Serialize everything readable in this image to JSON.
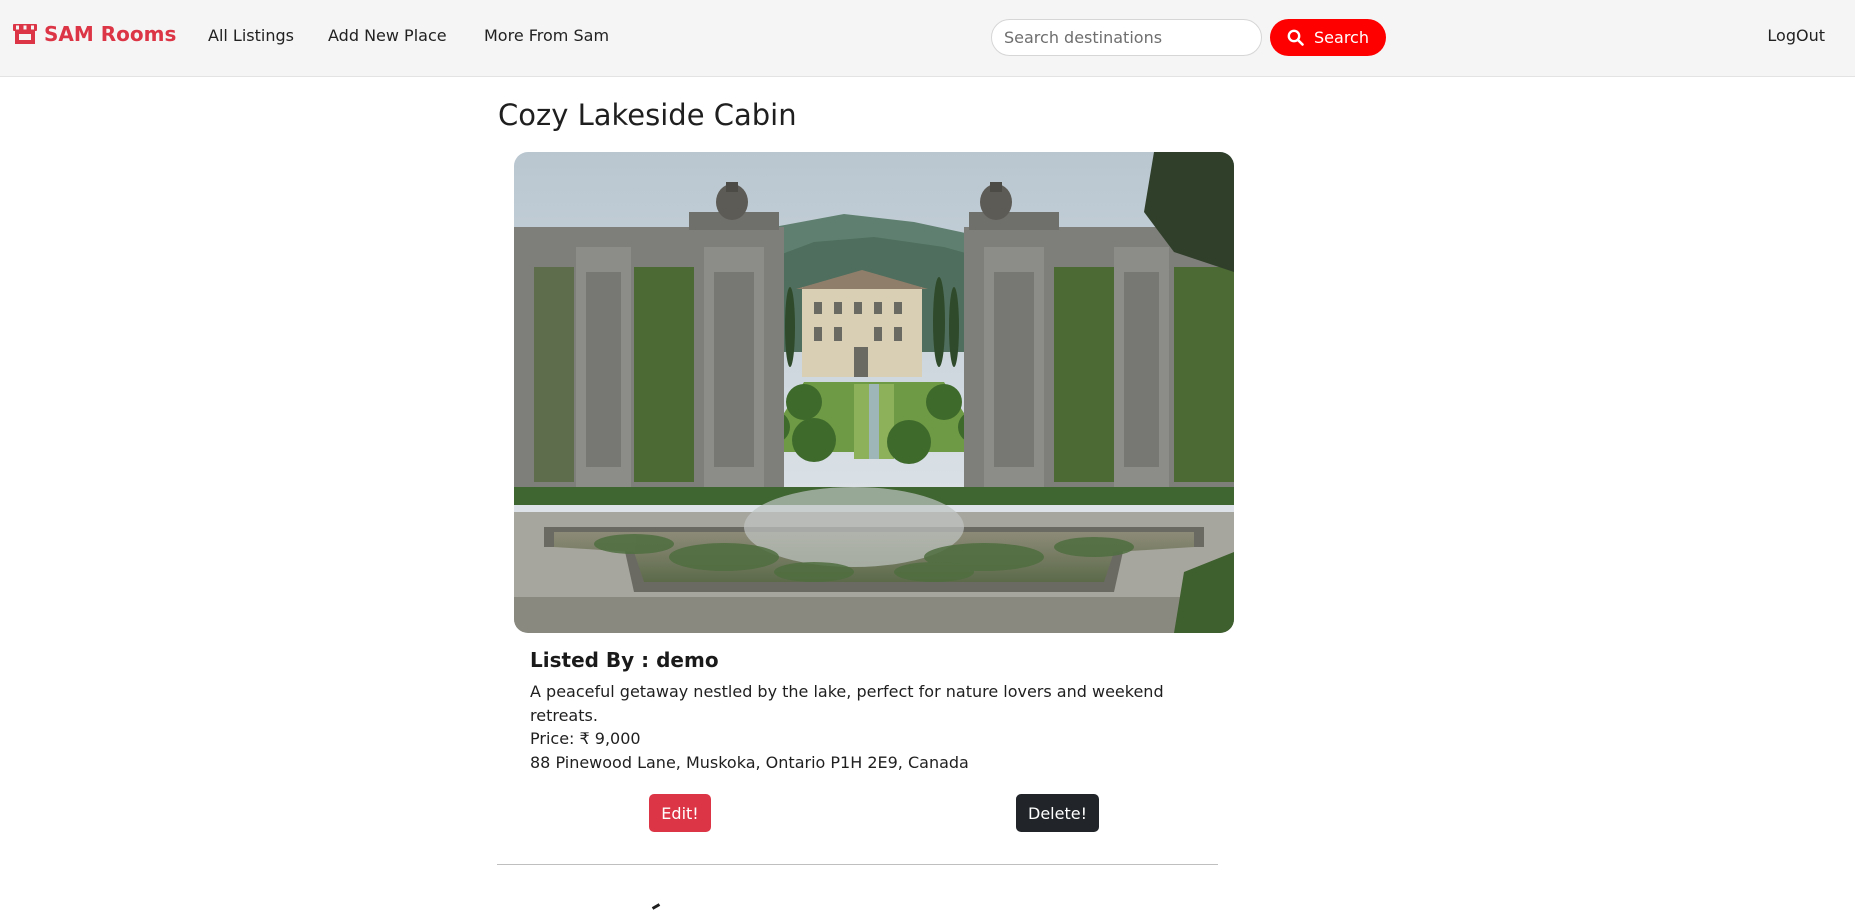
{
  "nav": {
    "brand": "SAM Rooms",
    "links": [
      "All Listings",
      "Add New Place",
      "More From Sam"
    ],
    "search_placeholder": "Search destinations",
    "search_button": "Search",
    "logout": "LogOut"
  },
  "listing": {
    "title": "Cozy Lakeside Cabin",
    "listed_by": "Listed By : demo",
    "description": "A peaceful getaway nestled by the lake, perfect for nature lovers and weekend retreats.",
    "price": "Price: ₹ 9,000",
    "address": "88 Pinewood Lane, Muskoka, Ontario P1H 2E9, Canada"
  },
  "actions": {
    "edit": "Edit!",
    "delete": "Delete!"
  },
  "colors": {
    "brand": "#dc3545",
    "search_button": "#fe0000",
    "delete_button": "#212529"
  },
  "icons": {
    "brand": "shop-icon",
    "search": "search-icon"
  }
}
